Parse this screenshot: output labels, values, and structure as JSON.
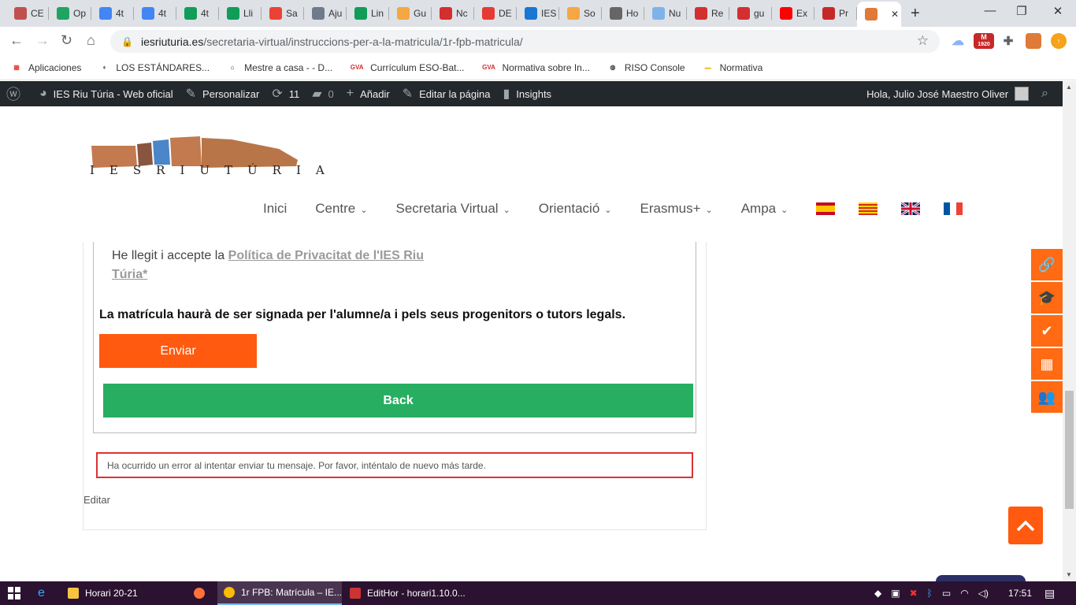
{
  "browser": {
    "tabs": [
      {
        "label": "CE",
        "color": "#c0504d"
      },
      {
        "label": "Op",
        "color": "#1fa463"
      },
      {
        "label": "4t",
        "color": "#4285f4"
      },
      {
        "label": "4t",
        "color": "#4285f4"
      },
      {
        "label": "4t",
        "color": "#0f9d58"
      },
      {
        "label": "Lli",
        "color": "#0f9d58"
      },
      {
        "label": "Sa",
        "color": "#ea4335"
      },
      {
        "label": "Aju",
        "color": "#6f7b8a"
      },
      {
        "label": "Lin",
        "color": "#0f9d58"
      },
      {
        "label": "Gu",
        "color": "#f4a742"
      },
      {
        "label": "Nc",
        "color": "#d32f2f"
      },
      {
        "label": "DE",
        "color": "#e53935"
      },
      {
        "label": "IES",
        "color": "#1976d2"
      },
      {
        "label": "So",
        "color": "#f4a742"
      },
      {
        "label": "Ho",
        "color": "#666666"
      },
      {
        "label": "Nu",
        "color": "#7db3e8"
      },
      {
        "label": "Re",
        "color": "#d32f2f"
      },
      {
        "label": "gu",
        "color": "#d32f2f"
      },
      {
        "label": "Ex",
        "color": "#ff0000"
      },
      {
        "label": "Pr",
        "color": "#c62828"
      },
      {
        "label": "",
        "color": "#e07a38"
      }
    ],
    "url_host": "iesriuturia.es",
    "url_path": "/secretaria-virtual/instruccions-per-a-la-matricula/1r-fpb-matricula/",
    "ext_badge": "1920",
    "ext_letter": "M",
    "bookmarks": [
      {
        "label": "Aplicaciones",
        "icon": "apps-grid-icon"
      },
      {
        "label": "LOS ESTÁNDARES...",
        "icon": "bookmark-icon"
      },
      {
        "label": "Mestre a casa - - D...",
        "icon": "house-icon"
      },
      {
        "label": "Currículum ESO-Bat...",
        "icon": "gva-icon",
        "mark": "GVA"
      },
      {
        "label": "Normativa sobre In...",
        "icon": "gva-icon",
        "mark": "GVA"
      },
      {
        "label": "RISO Console",
        "icon": "globe-icon"
      },
      {
        "label": "Normativa",
        "icon": "folder-icon"
      }
    ]
  },
  "adminbar": {
    "site_name": "IES Riu Túria - Web oficial",
    "customize": "Personalizar",
    "updates": "11",
    "comments": "0",
    "add_new": "Añadir",
    "edit_page": "Editar la página",
    "insights": "Insights",
    "greeting": "Hola, Julio José Maestro Oliver"
  },
  "site": {
    "logo_text": "IESRIUTÚRIA",
    "nav": [
      {
        "label": "Inici",
        "dropdown": false
      },
      {
        "label": "Centre",
        "dropdown": true
      },
      {
        "label": "Secretaria Virtual",
        "dropdown": true
      },
      {
        "label": "Orientació",
        "dropdown": true
      },
      {
        "label": "Erasmus+",
        "dropdown": true
      },
      {
        "label": "Ampa",
        "dropdown": true
      }
    ],
    "languages": [
      "es",
      "ca-valencia",
      "en",
      "fr"
    ]
  },
  "form": {
    "privacy_prefix": "He llegit i accepte la ",
    "privacy_link": "Política de Privacitat de l'IES Riu Túria*",
    "notice": "La matrícula haurà de ser signada per l'alumne/a i pels seus progenitors o tutors legals.",
    "submit_label": "Enviar",
    "back_label": "Back",
    "error_message": "Ha ocurrido un error al intentar enviar tu mensaje. Por favor, inténtalo de nuevo más tarde.",
    "edit_link": "Editar"
  },
  "side_icons": [
    "link-icon",
    "graduation-cap-icon",
    "check-icon",
    "building-icon",
    "users-icon"
  ],
  "taskbar": {
    "items": [
      {
        "label": "Horari 20-21",
        "active": false
      },
      {
        "label": "1r FPB: Matrícula – IE...",
        "active": true
      },
      {
        "label": "EditHor - horari1.10.0...",
        "active": false
      }
    ],
    "clock": "17:51"
  },
  "colors": {
    "accent_orange": "#ff5a0f",
    "back_green": "#27ae60",
    "error_red": "#dc3232",
    "adminbar_bg": "#23282d"
  }
}
